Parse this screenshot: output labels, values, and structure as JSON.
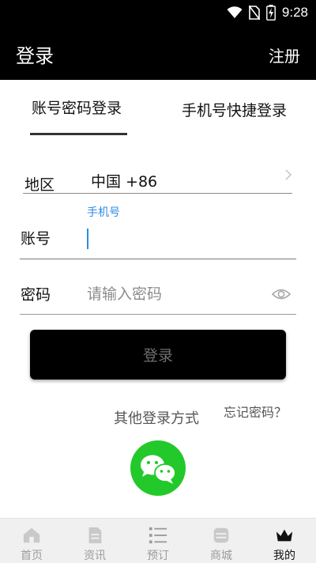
{
  "status_bar": {
    "time": "9:28"
  },
  "app_bar": {
    "title": "登录",
    "register": "注册"
  },
  "tabs": [
    {
      "label": "账号密码登录",
      "active": true
    },
    {
      "label": "手机号快捷登录",
      "active": false
    }
  ],
  "form": {
    "region_label": "地区",
    "region_value": "中国 +86",
    "account_label": "账号",
    "account_hint": "手机号",
    "account_value": "",
    "password_label": "密码",
    "password_placeholder": "请输入密码"
  },
  "login_button": "登录",
  "other_login": "其他登录方式",
  "forgot_password": "忘记密码？",
  "colors": {
    "accent": "#2d8ce4",
    "wechat": "#23c92a",
    "bar": "#000000"
  },
  "bottom_nav": [
    {
      "label": "首页",
      "icon": "home-icon",
      "active": false
    },
    {
      "label": "资讯",
      "icon": "news-icon",
      "active": false
    },
    {
      "label": "预订",
      "icon": "list-icon",
      "active": false
    },
    {
      "label": "商城",
      "icon": "shop-icon",
      "active": false
    },
    {
      "label": "我的",
      "icon": "crown-icon",
      "active": true
    }
  ]
}
